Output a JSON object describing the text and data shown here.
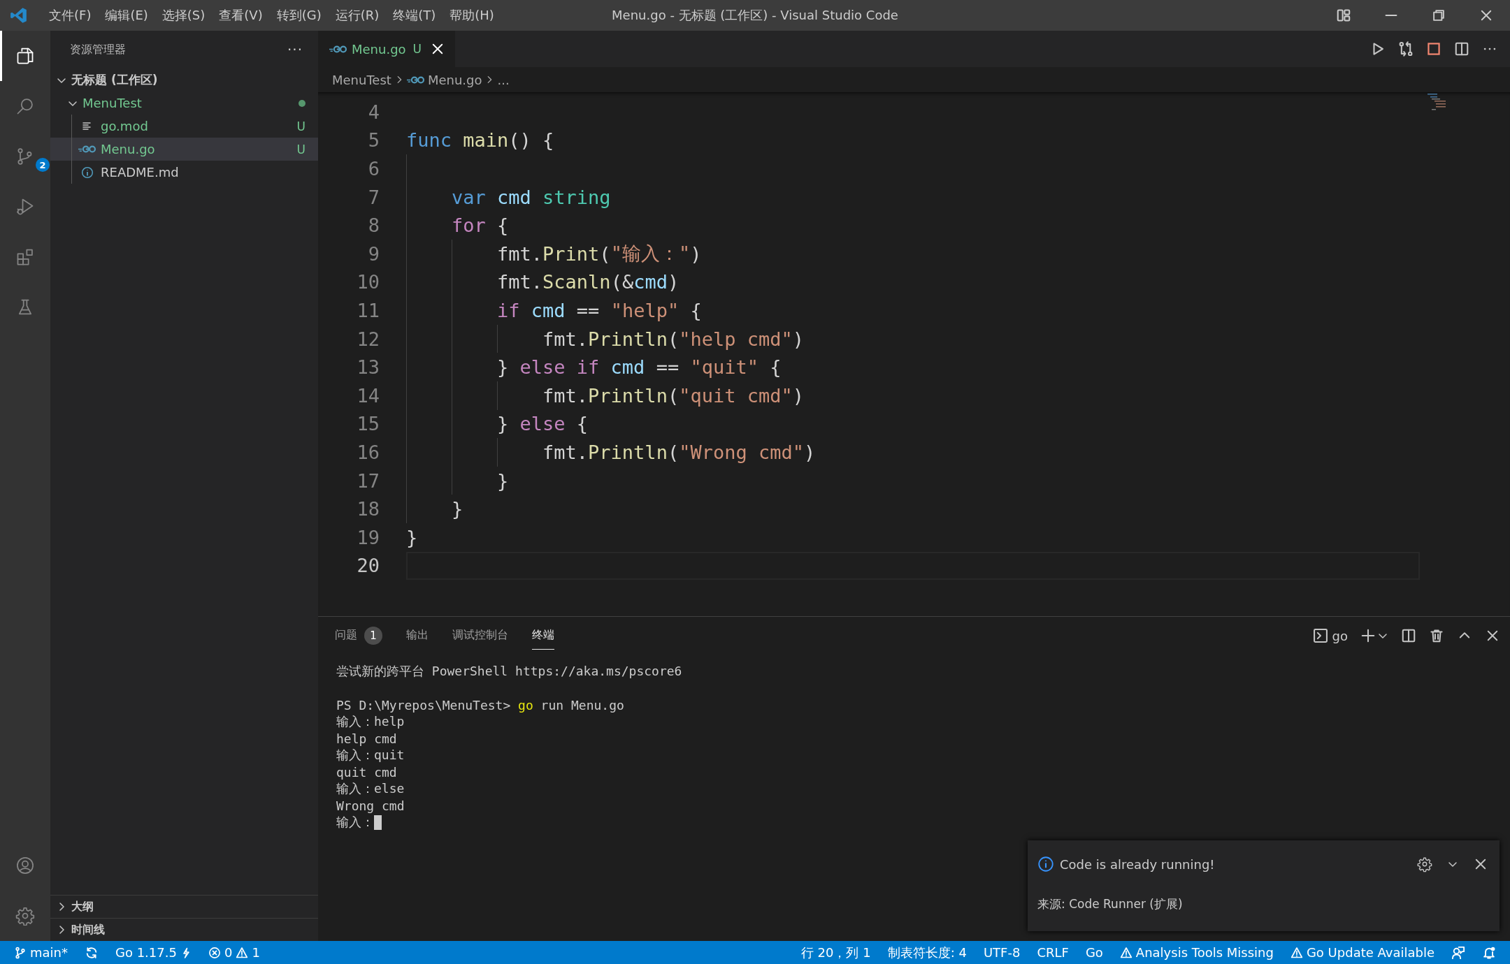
{
  "window": {
    "title": "Menu.go - 无标题 (工作区) - Visual Studio Code"
  },
  "menu": [
    "文件(F)",
    "编辑(E)",
    "选择(S)",
    "查看(V)",
    "转到(G)",
    "运行(R)",
    "终端(T)",
    "帮助(H)"
  ],
  "activity_bar": [
    {
      "kind": "files",
      "selected": true
    },
    {
      "kind": "search",
      "selected": false
    },
    {
      "kind": "source-control",
      "selected": false,
      "badge": "2"
    },
    {
      "kind": "run",
      "selected": false
    },
    {
      "kind": "extensions",
      "selected": false
    },
    {
      "kind": "testing",
      "selected": false
    }
  ],
  "sidebar": {
    "title": "资源管理器",
    "more": "···",
    "tree": [
      {
        "label": "无标题 (工作区)",
        "kind": "workspace",
        "expanded": true,
        "children": [
          {
            "label": "MenuTest",
            "kind": "folder",
            "expanded": true,
            "modified": true,
            "children": [
              {
                "label": "go.mod",
                "kind": "text-file",
                "status": "U",
                "selected": false
              },
              {
                "label": "Menu.go",
                "kind": "go-file",
                "status": "U",
                "selected": true
              },
              {
                "label": "README.md",
                "kind": "info-file",
                "selected": false
              }
            ]
          }
        ]
      }
    ],
    "sections": [
      {
        "label": "大纲",
        "expanded": false
      },
      {
        "label": "时间线",
        "expanded": false
      }
    ]
  },
  "editor": {
    "tabs": [
      {
        "label": "Menu.go",
        "status": "U",
        "selected": true
      }
    ],
    "breadcrumb": [
      "MenuTest",
      "Menu.go",
      "..."
    ],
    "lines": [
      {
        "number": "4",
        "current": false
      },
      {
        "number": "5",
        "current": false,
        "tokens": [
          {
            "text": "func ",
            "kind": "keyword"
          },
          {
            "text": "main",
            "kind": "function"
          },
          {
            "text": "() {",
            "kind": "plain"
          }
        ]
      },
      {
        "number": "6",
        "current": false
      },
      {
        "number": "7",
        "current": false,
        "tokens": [
          {
            "text": "    var ",
            "kind": "keyword"
          },
          {
            "text": "cmd ",
            "kind": "variable"
          },
          {
            "text": "string",
            "kind": "type"
          }
        ]
      },
      {
        "number": "8",
        "current": false,
        "tokens": [
          {
            "text": "    for",
            "kind": "control"
          },
          {
            "text": " {",
            "kind": "plain"
          }
        ]
      },
      {
        "number": "9",
        "current": false,
        "tokens": [
          {
            "text": "        fmt.",
            "kind": "plain"
          },
          {
            "text": "Print",
            "kind": "function"
          },
          {
            "text": "(",
            "kind": "plain"
          },
          {
            "text": "\"输入：\"",
            "kind": "string"
          },
          {
            "text": ")",
            "kind": "plain"
          }
        ]
      },
      {
        "number": "10",
        "current": false,
        "tokens": [
          {
            "text": "        fmt.",
            "kind": "plain"
          },
          {
            "text": "Scanln",
            "kind": "function"
          },
          {
            "text": "(&",
            "kind": "plain"
          },
          {
            "text": "cmd",
            "kind": "variable"
          },
          {
            "text": ")",
            "kind": "plain"
          }
        ]
      },
      {
        "number": "11",
        "current": false,
        "tokens": [
          {
            "text": "        if ",
            "kind": "control"
          },
          {
            "text": "cmd",
            "kind": "variable"
          },
          {
            "text": " == ",
            "kind": "plain"
          },
          {
            "text": "\"help\"",
            "kind": "string"
          },
          {
            "text": " {",
            "kind": "plain"
          }
        ]
      },
      {
        "number": "12",
        "current": false,
        "tokens": [
          {
            "text": "            fmt.",
            "kind": "plain"
          },
          {
            "text": "Println",
            "kind": "function"
          },
          {
            "text": "(",
            "kind": "plain"
          },
          {
            "text": "\"help cmd\"",
            "kind": "string"
          },
          {
            "text": ")",
            "kind": "plain"
          }
        ]
      },
      {
        "number": "13",
        "current": false,
        "tokens": [
          {
            "text": "        } ",
            "kind": "plain"
          },
          {
            "text": "else if ",
            "kind": "control"
          },
          {
            "text": "cmd",
            "kind": "variable"
          },
          {
            "text": " == ",
            "kind": "plain"
          },
          {
            "text": "\"quit\"",
            "kind": "string"
          },
          {
            "text": " {",
            "kind": "plain"
          }
        ]
      },
      {
        "number": "14",
        "current": false,
        "tokens": [
          {
            "text": "            fmt.",
            "kind": "plain"
          },
          {
            "text": "Println",
            "kind": "function"
          },
          {
            "text": "(",
            "kind": "plain"
          },
          {
            "text": "\"quit cmd\"",
            "kind": "string"
          },
          {
            "text": ")",
            "kind": "plain"
          }
        ]
      },
      {
        "number": "15",
        "current": false,
        "tokens": [
          {
            "text": "        } ",
            "kind": "plain"
          },
          {
            "text": "else",
            "kind": "control"
          },
          {
            "text": " {",
            "kind": "plain"
          }
        ]
      },
      {
        "number": "16",
        "current": false,
        "tokens": [
          {
            "text": "            fmt.",
            "kind": "plain"
          },
          {
            "text": "Println",
            "kind": "function"
          },
          {
            "text": "(",
            "kind": "plain"
          },
          {
            "text": "\"Wrong cmd\"",
            "kind": "string"
          },
          {
            "text": ")",
            "kind": "plain"
          }
        ]
      },
      {
        "number": "17",
        "current": false,
        "tokens": [
          {
            "text": "        }",
            "kind": "plain"
          }
        ]
      },
      {
        "number": "18",
        "current": false,
        "tokens": [
          {
            "text": "    }",
            "kind": "plain"
          }
        ]
      },
      {
        "number": "19",
        "current": false,
        "tokens": [
          {
            "text": "}",
            "kind": "plain"
          }
        ]
      },
      {
        "number": "20",
        "current": true
      }
    ]
  },
  "panel": {
    "tabs": [
      {
        "label": "问题",
        "badge": "1",
        "selected": false
      },
      {
        "label": "输出",
        "selected": false
      },
      {
        "label": "调试控制台",
        "selected": false
      },
      {
        "label": "终端",
        "selected": true
      }
    ],
    "terminal_name": "go",
    "terminal": [
      {
        "kind": "text",
        "segments": [
          {
            "text": "尝试新的跨平台 PowerShell https://aka.ms/pscore6",
            "kind": "plain"
          }
        ]
      },
      {
        "kind": "blank"
      },
      {
        "kind": "text",
        "segments": [
          {
            "text": "PS D:\\Myrepos\\MenuTest> ",
            "kind": "plain"
          },
          {
            "text": "go",
            "kind": "command"
          },
          {
            "text": " run Menu.go",
            "kind": "plain"
          }
        ]
      },
      {
        "kind": "text",
        "segments": [
          {
            "text": "输入：help",
            "kind": "plain"
          }
        ]
      },
      {
        "kind": "text",
        "segments": [
          {
            "text": "help cmd",
            "kind": "plain"
          }
        ]
      },
      {
        "kind": "text",
        "segments": [
          {
            "text": "输入：quit",
            "kind": "plain"
          }
        ]
      },
      {
        "kind": "text",
        "segments": [
          {
            "text": "quit cmd",
            "kind": "plain"
          }
        ]
      },
      {
        "kind": "text",
        "segments": [
          {
            "text": "输入：else",
            "kind": "plain"
          }
        ]
      },
      {
        "kind": "text",
        "segments": [
          {
            "text": "Wrong cmd",
            "kind": "plain"
          }
        ]
      },
      {
        "kind": "text",
        "cursor": true,
        "segments": [
          {
            "text": "输入：",
            "kind": "plain"
          }
        ]
      }
    ]
  },
  "notification": {
    "message": "Code is already running!",
    "source": "来源: Code Runner (扩展)"
  },
  "status_bar": {
    "left": [
      {
        "kind": "branch",
        "text": "main*"
      },
      {
        "kind": "sync"
      },
      {
        "kind": "go-version",
        "text": "Go 1.17.5"
      },
      {
        "kind": "problems",
        "errors": "0",
        "warnings": "1"
      }
    ],
    "right": [
      {
        "kind": "text",
        "text": "行 20，列 1"
      },
      {
        "kind": "text",
        "text": "制表符长度: 4"
      },
      {
        "kind": "text",
        "text": "UTF-8"
      },
      {
        "kind": "text",
        "text": "CRLF"
      },
      {
        "kind": "text",
        "text": "Go"
      },
      {
        "kind": "warning",
        "text": "Analysis Tools Missing"
      },
      {
        "kind": "warning",
        "text": "Go Update Available"
      },
      {
        "kind": "feedback"
      },
      {
        "kind": "bell"
      }
    ]
  }
}
